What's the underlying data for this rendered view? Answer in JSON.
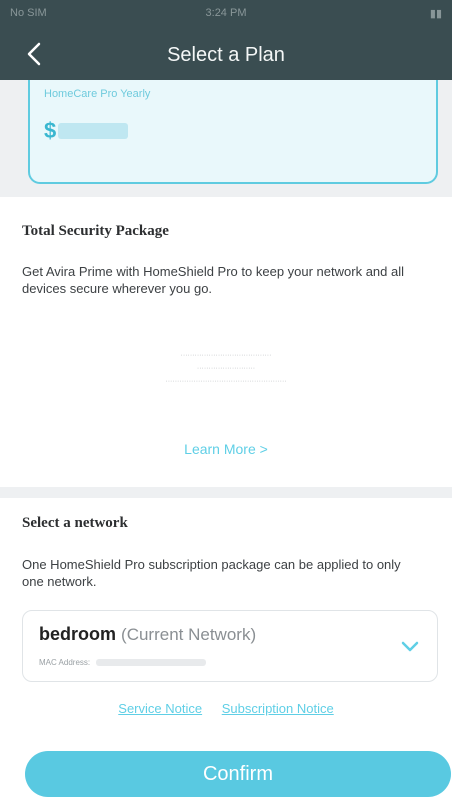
{
  "status_bar": {
    "carrier": "No SIM",
    "time": "3:24 PM",
    "battery": ""
  },
  "header": {
    "title": "Select a Plan",
    "back_icon": "chevron-left-icon"
  },
  "plan": {
    "name": "HomeCare Pro Yearly",
    "currency": "$"
  },
  "security": {
    "title": "Total Security Package",
    "description": "Get Avira Prime with HomeShield Pro to keep your network and all devices secure wherever you go.",
    "learn_more": "Learn More >"
  },
  "network": {
    "title": "Select a network",
    "description": "One HomeShield Pro subscription package can be applied to only one network.",
    "selected_name": "bedroom",
    "selected_tag": "(Current Network)",
    "mac_label": "MAC Address:"
  },
  "links": {
    "service_notice": "Service Notice",
    "subscription_notice": "Subscription Notice"
  },
  "confirm_label": "Confirm",
  "colors": {
    "header_bg": "#3a4d51",
    "accent": "#5fcfe6",
    "button": "#59c9e1"
  }
}
